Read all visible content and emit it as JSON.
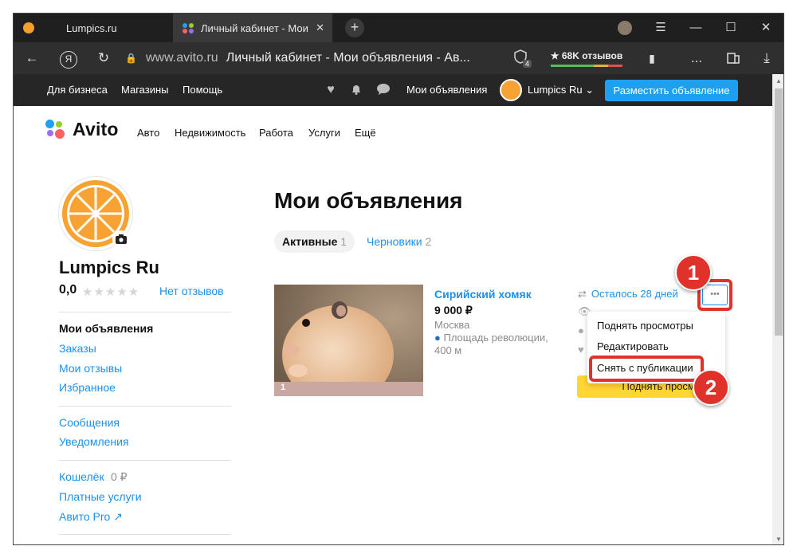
{
  "browser": {
    "tabs": [
      {
        "title": "Lumpics.ru"
      },
      {
        "title": "Личный кабинет - Мои",
        "close": "✕"
      }
    ],
    "newtab": "+",
    "address_domain": "www.avito.ru",
    "address_title": "Личный кабинет - Мои объявления - Ав...",
    "reviews_label": "★ 68K отзывов",
    "extension_badge": "4",
    "controls": {
      "menu": "☰",
      "minimize": "—",
      "maximize": "☐",
      "close": "✕"
    },
    "toolbar": {
      "back": "←",
      "yandex": "Я",
      "reload": "↻",
      "bookmark": "▮",
      "more": "...",
      "download": "⤓"
    }
  },
  "topnav": {
    "business": "Для бизнеса",
    "shops": "Магазины",
    "help": "Помощь",
    "my_ads": "Мои объявления",
    "user": "Lumpics Ru",
    "user_chevron": "⌄",
    "post_ad": "Разместить объявление"
  },
  "mainnav": {
    "logo": "Avito",
    "items": [
      "Авто",
      "Недвижимость",
      "Работа",
      "Услуги",
      "Ещё"
    ]
  },
  "profile": {
    "name": "Lumpics Ru",
    "rating": "0,0",
    "stars": "★★★★★",
    "no_reviews": "Нет отзывов"
  },
  "sidebar": {
    "group1": [
      "Мои объявления",
      "Заказы",
      "Мои отзывы",
      "Избранное"
    ],
    "group2": [
      "Сообщения",
      "Уведомления"
    ],
    "group3": [
      "Кошелёк",
      "Платные услуги",
      "Авито Pro ↗"
    ],
    "wallet_value": "0 ₽"
  },
  "main": {
    "title": "Мои объявления",
    "tab_active": "Активные",
    "tab_active_count": "1",
    "tab_drafts": "Черновики",
    "tab_drafts_count": "2"
  },
  "ad": {
    "title": "Сирийский хомяк",
    "price": "9 000 ₽",
    "city": "Москва",
    "metro": "Площадь революции, 400 м",
    "photo_index": "1",
    "remaining": "Осталось 28 дней",
    "raise_button": "Поднять просмотр",
    "more_button": "•••"
  },
  "dropdown": {
    "items": [
      "Поднять просмотры",
      "Редактировать",
      "Снять с публикации"
    ]
  },
  "annotations": {
    "step1": "1",
    "step2": "2",
    "color": "#e0322b"
  },
  "colors": {
    "accent_blue": "#1e90e6",
    "post_button": "#1ea0f0",
    "raise_button": "#ffd633",
    "avatar_orange": "#f7a233"
  }
}
